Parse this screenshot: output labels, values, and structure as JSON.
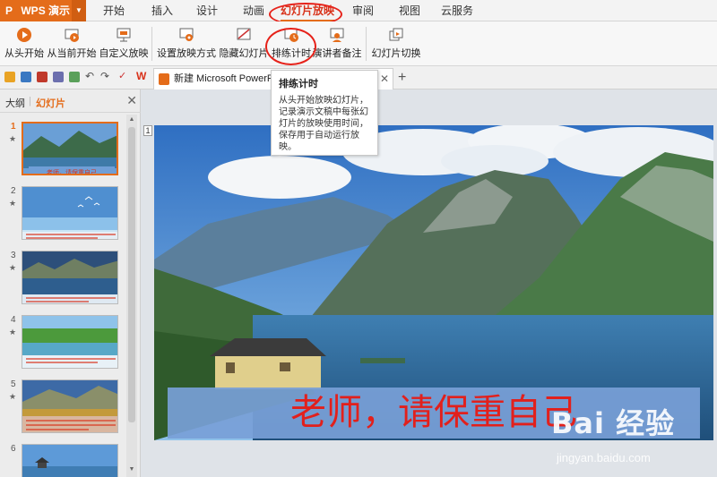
{
  "app": {
    "name": "WPS 演示",
    "logo_text": "P",
    "accent": "#e46c1a",
    "highlight": "#e6221a"
  },
  "menu": {
    "tabs": [
      {
        "label": "开始"
      },
      {
        "label": "插入"
      },
      {
        "label": "设计"
      },
      {
        "label": "动画"
      },
      {
        "label": "幻灯片放映"
      },
      {
        "label": "审阅"
      },
      {
        "label": "视图"
      },
      {
        "label": "云服务"
      }
    ],
    "active": "幻灯片放映"
  },
  "ribbon": {
    "buttons": [
      {
        "label": "从头开始",
        "icon": "play-circle-icon"
      },
      {
        "label": "从当前开始",
        "icon": "play-from-current-icon"
      },
      {
        "label": "自定义放映",
        "icon": "custom-show-icon"
      },
      {
        "label": "设置放映方式",
        "icon": "setup-show-icon"
      },
      {
        "label": "隐藏幻灯片",
        "icon": "hide-slide-icon"
      },
      {
        "label": "排练计时",
        "icon": "rehearse-timing-icon"
      },
      {
        "label": "演讲者备注",
        "icon": "speaker-notes-icon"
      },
      {
        "label": "幻灯片切换",
        "icon": "slide-transition-icon"
      }
    ]
  },
  "document": {
    "tab_title": "新建 Microsoft PowerPoint 演示文稿.pptx"
  },
  "tooltip": {
    "title": "排练计时",
    "body": "从头开始放映幻灯片，记录演示文稿中每张幻灯片的放映使用时间，保存用于自动运行放映。"
  },
  "left_pane": {
    "tabs": [
      {
        "label": "大纲"
      },
      {
        "label": "幻灯片"
      }
    ],
    "active": "幻灯片",
    "thumbnails": [
      {
        "num": "1",
        "star": "★"
      },
      {
        "num": "2",
        "star": "★"
      },
      {
        "num": "3",
        "star": "★"
      },
      {
        "num": "4",
        "star": "★"
      },
      {
        "num": "5",
        "star": "★"
      },
      {
        "num": "6",
        "star": ""
      }
    ],
    "selected": "1"
  },
  "slide": {
    "number": "1",
    "caption": "老师，请保重自己"
  },
  "watermark": {
    "logo": "Bai 经验",
    "url": "jingyan.baidu.com"
  }
}
